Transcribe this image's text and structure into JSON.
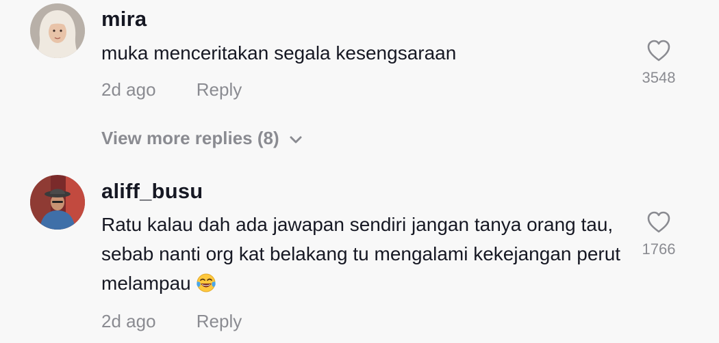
{
  "comments": [
    {
      "username": "mira",
      "text": "muka menceritakan segala kesengsaraan",
      "time": "2d ago",
      "reply_label": "Reply",
      "likes": "3548",
      "avatar_icon": "user-avatar-hijab"
    },
    {
      "username": "aliff_busu",
      "text": "Ratu kalau dah ada jawapan sendiri jangan tanya orang tau, sebab nanti org kat belakang tu mengalami kekejangan perut melampau",
      "emoji": "face-with-tears-of-joy",
      "time": "2d ago",
      "reply_label": "Reply",
      "likes": "1766",
      "avatar_icon": "user-avatar-hat"
    }
  ],
  "view_more": {
    "label": "View more replies (8)"
  },
  "colors": {
    "background": "#f8f8f8",
    "primary_text": "#161823",
    "secondary_text": "#8a8b91"
  }
}
